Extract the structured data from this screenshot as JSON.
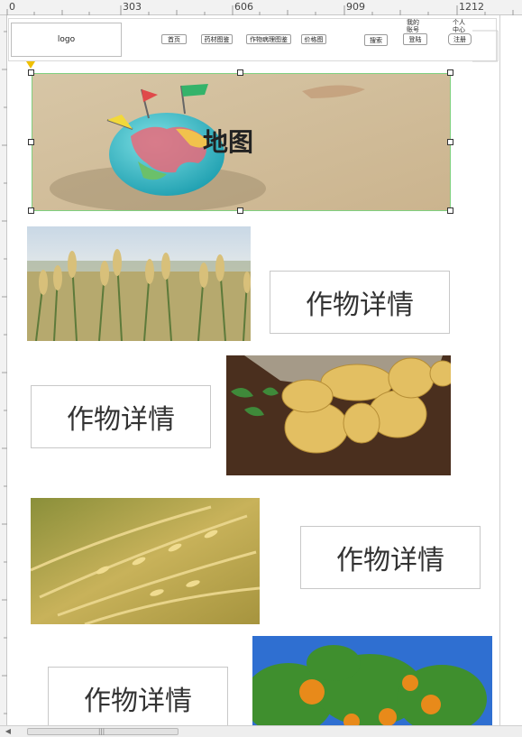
{
  "ruler": {
    "marks": [
      "0",
      "303",
      "606",
      "909",
      "1212"
    ]
  },
  "header": {
    "logo": "logo",
    "nav": [
      "首页",
      "药材图鉴",
      "作物病理图鉴",
      "价格图"
    ],
    "search_label": "搜索",
    "account_caption": "我的\n账号",
    "login_label": "登陆",
    "user_caption": "个人\n中心",
    "register_label": "注册"
  },
  "hero": {
    "caption": "地图"
  },
  "details": [
    {
      "label": "作物详情",
      "image_icon": "wheat-field-image"
    },
    {
      "label": "作物详情",
      "image_icon": "potato-image"
    },
    {
      "label": "作物详情",
      "image_icon": "rice-stalks-image"
    },
    {
      "label": "作物详情",
      "image_icon": "orange-tree-image"
    }
  ],
  "colors": {
    "selection": "#7fd07f",
    "marker": "#f0c000"
  }
}
